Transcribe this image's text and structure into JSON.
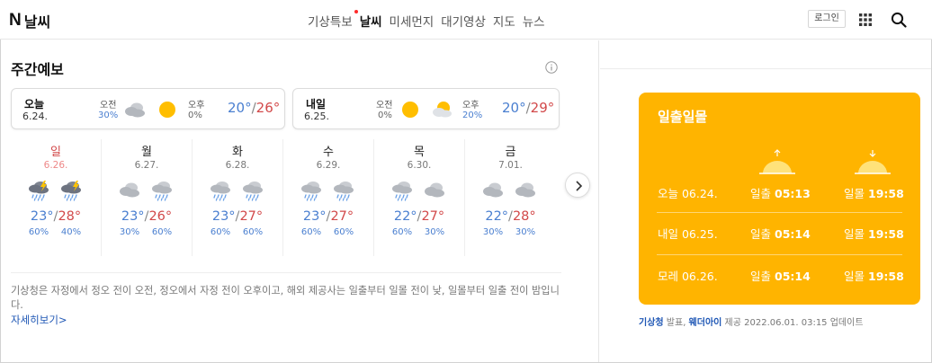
{
  "header": {
    "logo_mark": "N",
    "title": "날씨",
    "nav": [
      {
        "label": "기상특보",
        "active": false,
        "has_dot": true
      },
      {
        "label": "날씨",
        "active": true,
        "has_dot": false
      },
      {
        "label": "미세먼지",
        "active": false,
        "has_dot": false
      },
      {
        "label": "대기영상",
        "active": false,
        "has_dot": false
      },
      {
        "label": "지도",
        "active": false,
        "has_dot": false
      },
      {
        "label": "뉴스",
        "active": false,
        "has_dot": false
      }
    ],
    "login_label": "로그인",
    "icons": {
      "apps": "grid-icon",
      "search": "search-icon"
    }
  },
  "weekly": {
    "title": "주간예보",
    "info_icon": "info-icon",
    "today": {
      "name": "오늘",
      "date": "6.24.",
      "am_label": "오전",
      "am_pct": "30%",
      "am_icon": "cloudy",
      "pm_label": "오후",
      "pm_pct": "0%",
      "pm_icon": "sunny",
      "low": "20°",
      "sep": "/",
      "high": "26°"
    },
    "tomorrow": {
      "name": "내일",
      "date": "6.25.",
      "am_label": "오전",
      "am_pct": "0%",
      "am_icon": "sunny",
      "pm_label": "오후",
      "pm_pct": "20%",
      "pm_icon": "partly-cloudy",
      "low": "20°",
      "sep": "/",
      "high": "29°"
    },
    "days": [
      {
        "day": "일",
        "date": "6.26.",
        "sunday": true,
        "am_icon": "thunder-rain",
        "pm_icon": "thunder-rain",
        "low": "23°",
        "high": "28°",
        "am_pct": "60%",
        "pm_pct": "40%"
      },
      {
        "day": "월",
        "date": "6.27.",
        "sunday": false,
        "am_icon": "cloudy",
        "pm_icon": "rain",
        "low": "23°",
        "high": "26°",
        "am_pct": "30%",
        "pm_pct": "60%"
      },
      {
        "day": "화",
        "date": "6.28.",
        "sunday": false,
        "am_icon": "rain",
        "pm_icon": "rain",
        "low": "23°",
        "high": "27°",
        "am_pct": "60%",
        "pm_pct": "60%"
      },
      {
        "day": "수",
        "date": "6.29.",
        "sunday": false,
        "am_icon": "rain",
        "pm_icon": "rain",
        "low": "23°",
        "high": "27°",
        "am_pct": "60%",
        "pm_pct": "60%"
      },
      {
        "day": "목",
        "date": "6.30.",
        "sunday": false,
        "am_icon": "rain",
        "pm_icon": "cloudy",
        "low": "22°",
        "high": "27°",
        "am_pct": "60%",
        "pm_pct": "30%"
      },
      {
        "day": "금",
        "date": "7.01.",
        "sunday": false,
        "am_icon": "cloudy",
        "pm_icon": "cloudy",
        "low": "22°",
        "high": "28°",
        "am_pct": "30%",
        "pm_pct": "30%"
      }
    ],
    "next_icon": "chevron-right-icon",
    "notice": "기상청은 자정에서 정오 전이 오전, 정오에서 자정 전이 오후이고, 해외 제공사는 일출부터 일몰 전이 낮, 일몰부터 일출 전이 밤입니다.",
    "more_link": "자세히보기",
    "more_arrow": ">"
  },
  "sun": {
    "title": "일출일몰",
    "rise_icon": "sunrise-icon",
    "set_icon": "sunset-icon",
    "rise_label": "일출",
    "set_label": "일몰",
    "rows": [
      {
        "day": "오늘 06.24.",
        "rise": "05:13",
        "set": "19:58"
      },
      {
        "day": "내일 06.25.",
        "rise": "05:14",
        "set": "19:58"
      },
      {
        "day": "모레 06.26.",
        "rise": "05:14",
        "set": "19:58"
      }
    ],
    "source": {
      "kma": "기상청",
      "sep1": " 발표, ",
      "weatheri": "웨더아이",
      "rest": " 제공 2022.06.01. 03:15 업데이트"
    }
  },
  "colors": {
    "accent": "#ffb400",
    "temp_low": "#4a7fd0",
    "temp_high": "#d2494a",
    "link": "#1f57b5",
    "nav_dot": "#ff2a2a"
  }
}
